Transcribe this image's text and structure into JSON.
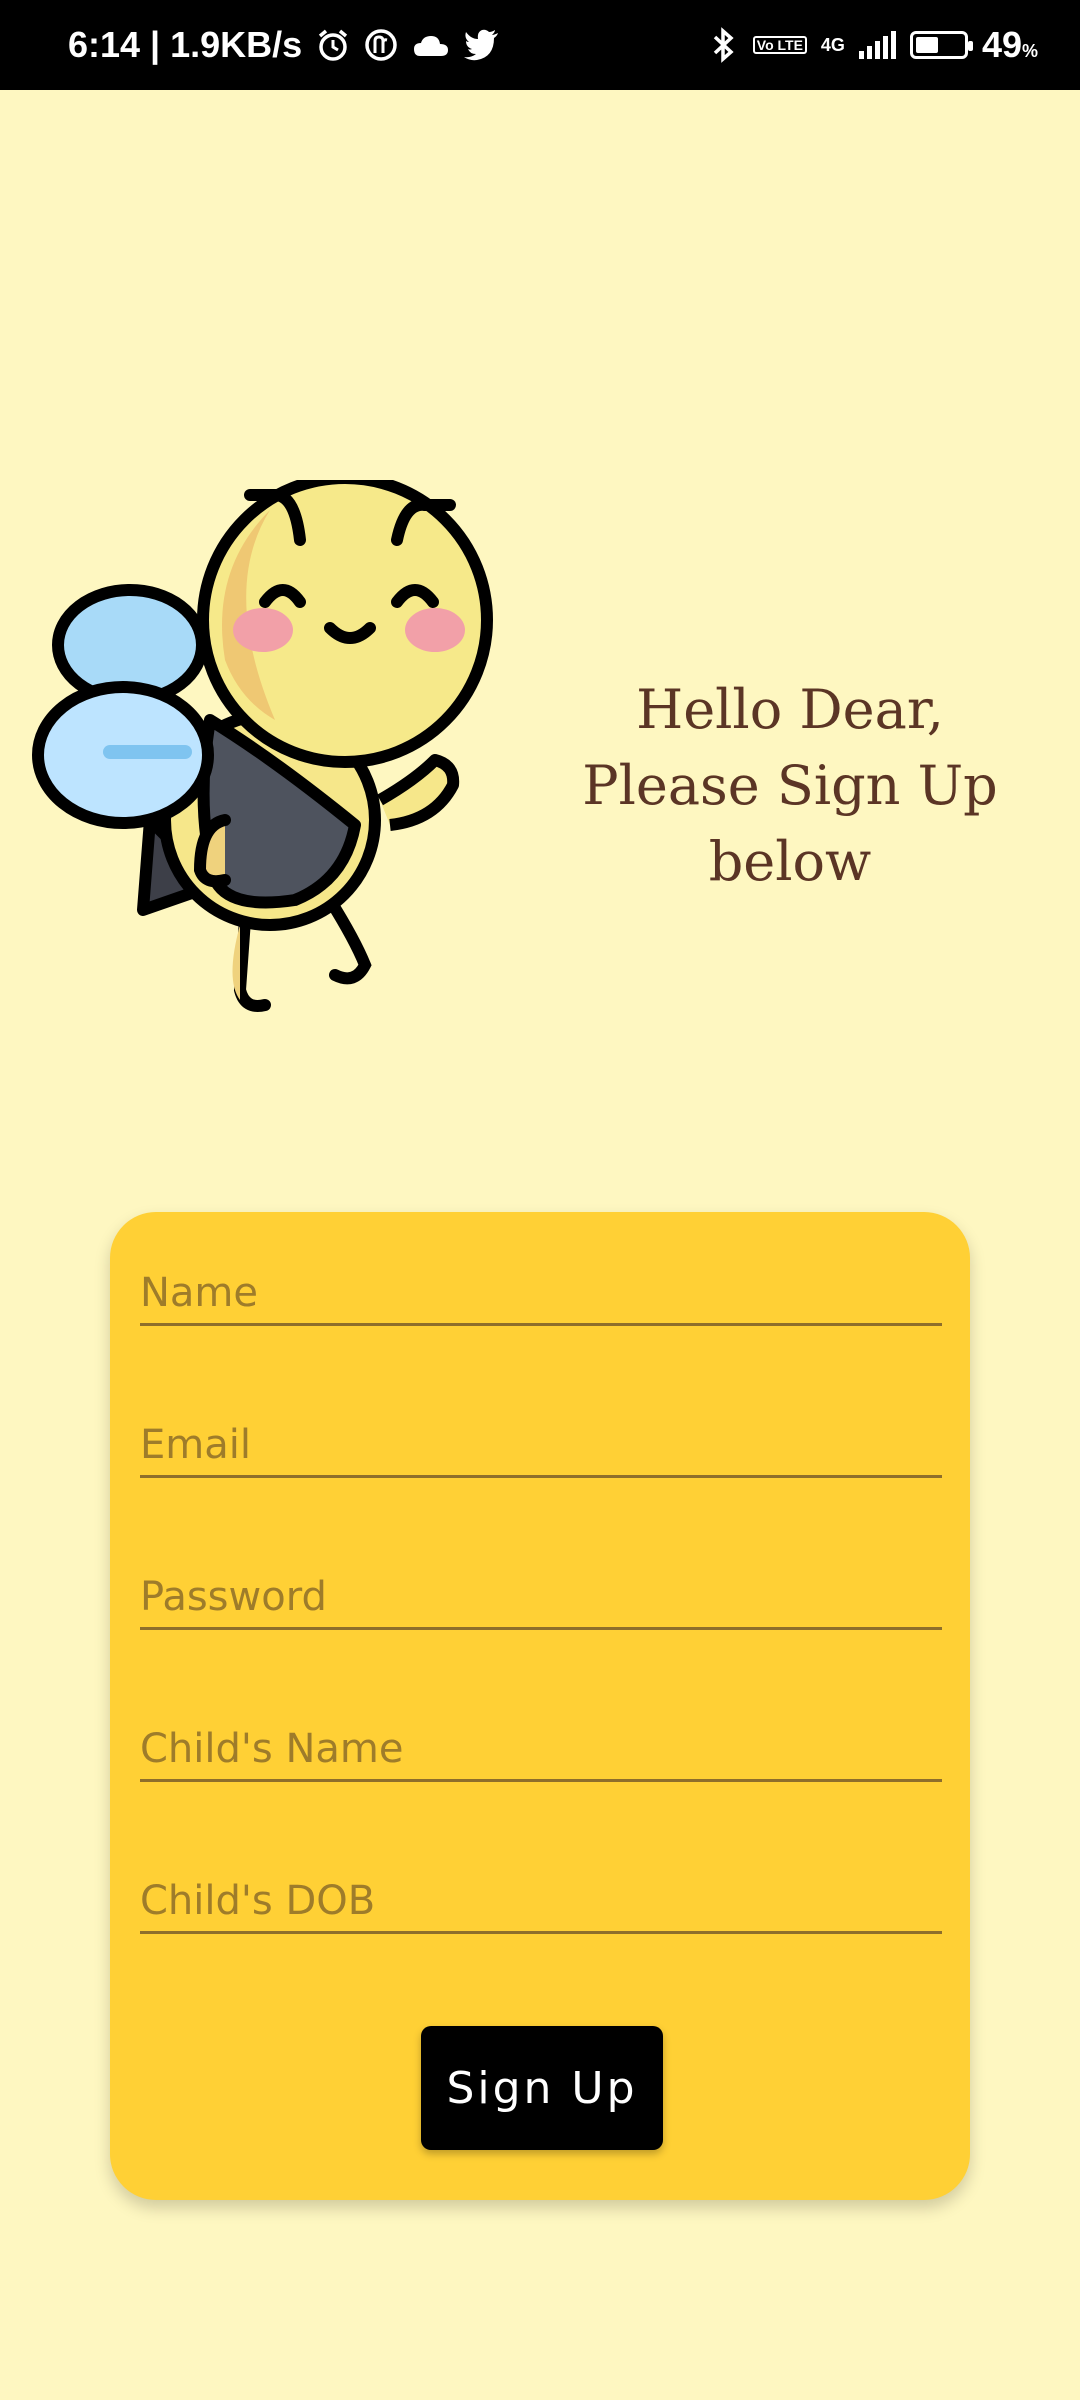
{
  "status_bar": {
    "time_speed": "6:14 | 1.9KB/s",
    "network": "4G",
    "lte": "Vo LTE",
    "battery_percent": "49",
    "battery_unit": "%",
    "battery_level": 0.49
  },
  "greeting": {
    "line1": "Hello Dear,",
    "line2": "Please Sign Up below"
  },
  "form": {
    "name_placeholder": "Name",
    "email_placeholder": "Email",
    "password_placeholder": "Password",
    "child_name_placeholder": "Child's Name",
    "child_dob_placeholder": "Child's DOB",
    "signup_label": "Sign Up"
  },
  "colors": {
    "background": "#FEF7C1",
    "card": "#FFD035",
    "text": "#5B3525",
    "button": "#000000"
  }
}
